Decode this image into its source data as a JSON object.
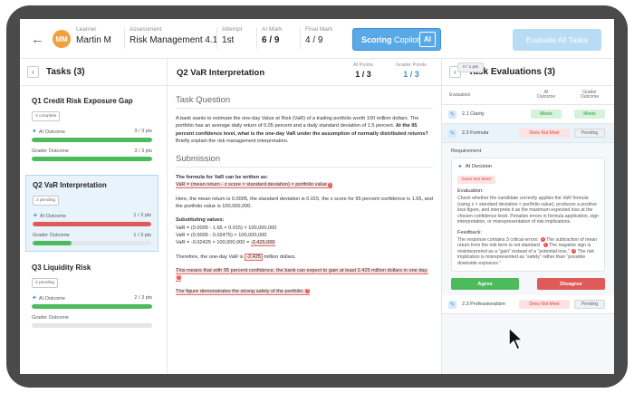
{
  "header": {
    "back_icon": "arrow-left",
    "avatar_initials": "MM",
    "learner_label": "Learner",
    "learner_name": "Martin M",
    "assessment_label": "Assessment",
    "assessment_name": "Risk Management 4.1",
    "attempt_label": "Attempt",
    "attempt_value": "1st",
    "ai_mark_label": "AI Mark",
    "ai_mark_value": "6 / 9",
    "final_mark_label": "Final Mark",
    "final_mark_value": "4 / 9",
    "copilot_bold": "Scoring",
    "copilot_rest": "Copilot",
    "copilot_icon": "AI",
    "evaluate_all": "Evaluate All Tasks"
  },
  "tasks_panel": {
    "title": "Tasks (3)",
    "ai_outcome_label": "AI Outcome",
    "grader_outcome_label": "Grader Outcome",
    "tasks": [
      {
        "title": "Q1 Credit Risk Exposure Gap",
        "tag": "3 complete",
        "ai_pts": "3 / 3 pts",
        "ai_fill": 1.0,
        "ai_color": "#4cbb5c",
        "grader_pts": "3 / 3 pts",
        "grader_fill": 1.0,
        "grader_color": "#4cbb5c"
      },
      {
        "title": "Q2 VaR Interpretation",
        "tag": "2 pending",
        "ai_pts": "1 / 3 pts",
        "ai_fill": 1.0,
        "ai_color": "#e05a5a",
        "grader_pts": "1 / 3 pts",
        "grader_fill": 0.33,
        "grader_color": "#4cbb5c"
      },
      {
        "title": "Q3 Liquidity Risk",
        "tag": "3 pending",
        "ai_pts": "2 / 3 pts",
        "ai_fill": 1.0,
        "ai_color": "#4cbb5c",
        "grader_pts": "",
        "grader_fill": 0,
        "grader_color": "#4cbb5c"
      }
    ]
  },
  "question": {
    "title": "Q2 VaR Interpretation",
    "ai_points_label": "AI Points",
    "ai_points": "1 / 3",
    "grader_points_label": "Grader Points",
    "grader_points": "1 / 3",
    "task_question_heading": "Task Question",
    "question_text_a": "A bank wants to estimate the one-day Value at Risk (VaR) of a trading portfolio worth 100 million dollars. The portfolio has an average daily return of 0.05 percent and a daily standard deviation of 1.5 percent.",
    "question_text_bold": "At the 95 percent confidence level, what is the one-day VaR under the assumption of normally distributed returns?",
    "question_text_b": "Briefly explain the risk management interpretation.",
    "submission_heading": "Submission",
    "sub_formula_heading": "The formula for VaR can be written as:",
    "sub_formula": "VaR = (mean return - z score × standard deviation) × portfolio value",
    "sub_para2": "Here, the mean return is 0.0005, the standard deviation is 0.015, the z score for 95 percent confidence is 1.65, and the portfolio value is 100,000,000.",
    "sub_values_heading": "Substituting values:",
    "sub_line1": "VaR = (0.0005 - 1.65 × 0.015) × 100,000,000",
    "sub_line2": "VaR = (0.0005 - 0.02475) × 100,000,000",
    "sub_line3_pre": "VaR = -0.02425 × 100,000,000 =",
    "sub_line3_val": "-2,425,000",
    "sub_therefore_pre": "Therefore, the one-day VaR is",
    "sub_therefore_val": "-2,425",
    "sub_therefore_post": "million dollars.",
    "sub_meaning": "This means that with 95 percent confidence, the bank can expect to gain at least 2.425 million dollars in one day.",
    "sub_safety": "The figure demonstrates the strong safety of the portfolio.",
    "markers": [
      "1",
      "2",
      "3"
    ]
  },
  "evaluations": {
    "title": "Task Evaluations (3)",
    "col_evaluation": "Evaluation",
    "col_ai": "AI",
    "col_ai_outcome": "Outcome",
    "col_grader": "Grader",
    "col_grader_outcome": "Outcome",
    "rows": [
      {
        "name": "2.1 Clarity",
        "ai": "Meets",
        "grader": "Meets"
      },
      {
        "name": "2.2 Formula",
        "ai": "Does Not Meet",
        "grader": "Pending"
      },
      {
        "name": "2.3 Professionalism",
        "ai": "Does Not Meet",
        "grader": "Pending"
      }
    ],
    "requirement_label": "Requirement",
    "ai_decision_label": "AI Decision",
    "decision_pill": "Does Not Meet",
    "decision_pts": "0 / 1 pts",
    "evaluation_label": "Evaluation:",
    "evaluation_text": "Check whether the candidate correctly applies the VaR formula (using z × standard deviation × portfolio value), produces a positive loss figure, and interprets it as the maximum expected loss at the chosen confidence level. Penalize errors in formula application, sign interpretation, or misrepresentation of risk implications.",
    "feedback_label": "Feedback:",
    "feedback_a": "The response contains 3 critical errors:",
    "feedback_b": "The subtraction of mean return from the risk term is not standard.",
    "feedback_c": "The negative sign is misinterpreted as a “gain” instead of a “potential loss.”",
    "feedback_d": "The risk implication is misrepresented as “safety” rather than “possible downside exposure.”",
    "agree": "Agree",
    "disagree": "Disagree"
  },
  "colors": {
    "accent": "#3d8fd8",
    "success": "#4cbb5c",
    "danger": "#e05a5a",
    "warning": "#f2a03d"
  }
}
